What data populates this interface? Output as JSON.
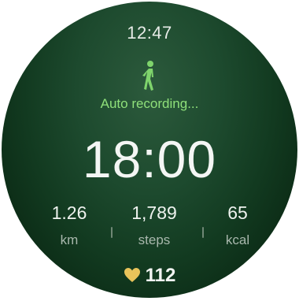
{
  "watch": {
    "time": "12:47",
    "activity_icon": "walking-person-icon",
    "status_text": "Auto recording...",
    "duration": "18:00"
  },
  "stats": {
    "distance": {
      "value": "1.26",
      "unit": "km"
    },
    "steps": {
      "value": "1,789",
      "unit": "steps"
    },
    "calories": {
      "value": "65",
      "unit": "kcal"
    }
  },
  "heart_rate": {
    "icon": "heart-icon",
    "value": "112"
  },
  "colors": {
    "accent": "#8fe07a",
    "heart": "#e8c35a",
    "background": "#163f24"
  }
}
